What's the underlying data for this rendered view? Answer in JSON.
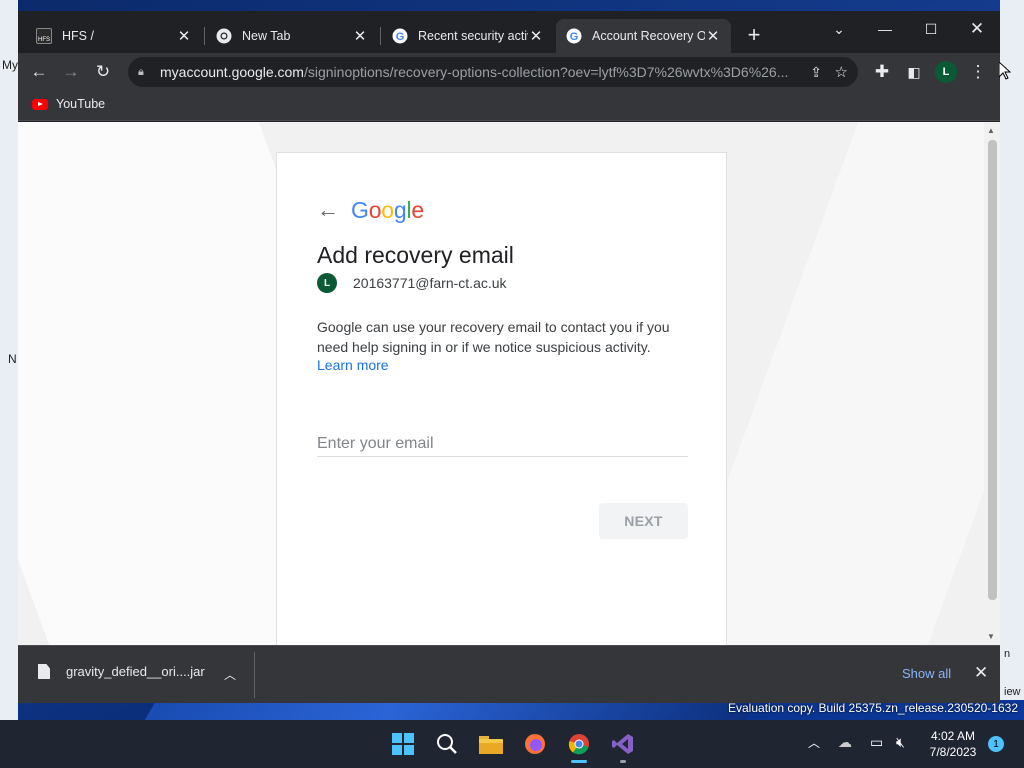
{
  "desktop": {
    "left_labels": [
      "My",
      "N"
    ],
    "right_labels": [
      "n",
      "iew"
    ],
    "evaluation_text": "Evaluation copy. Build 25375.zn_release.230520-1632"
  },
  "browser": {
    "tabs": [
      {
        "title": "HFS /",
        "favicon": "hfs-icon"
      },
      {
        "title": "New Tab",
        "favicon": "chrome-icon"
      },
      {
        "title": "Recent security activi",
        "favicon": "google-icon"
      },
      {
        "title": "Account Recovery Op",
        "favicon": "google-icon"
      }
    ],
    "new_tab_label": "+",
    "address": {
      "host": "myaccount.google.com",
      "path": "/signinoptions/recovery-options-collection?oev=lytf%3D7%26wvtx%3D6%26..."
    },
    "profile_initial": "L",
    "bookmarks": [
      {
        "label": "YouTube",
        "icon": "youtube-icon"
      }
    ]
  },
  "page": {
    "logo_text": "Google",
    "heading": "Add recovery email",
    "account_initial": "L",
    "account_email": "20163771@farn-ct.ac.uk",
    "description": "Google can use your recovery email to contact you if you need help signing in or if we notice suspicious activity.",
    "learn_more": "Learn more",
    "email_placeholder": "Enter your email",
    "next_label": "NEXT"
  },
  "downloads": {
    "file_name": "gravity_defied__ori....jar",
    "show_all": "Show all"
  },
  "taskbar": {
    "time": "4:02 AM",
    "date": "7/8/2023",
    "notification_count": "1"
  },
  "colors": {
    "google_blue": "#4285F4",
    "google_red": "#EA4335",
    "google_yellow": "#FBBC05",
    "google_green": "#34A853",
    "link": "#1a73e8",
    "avatar": "#0b5a36"
  }
}
